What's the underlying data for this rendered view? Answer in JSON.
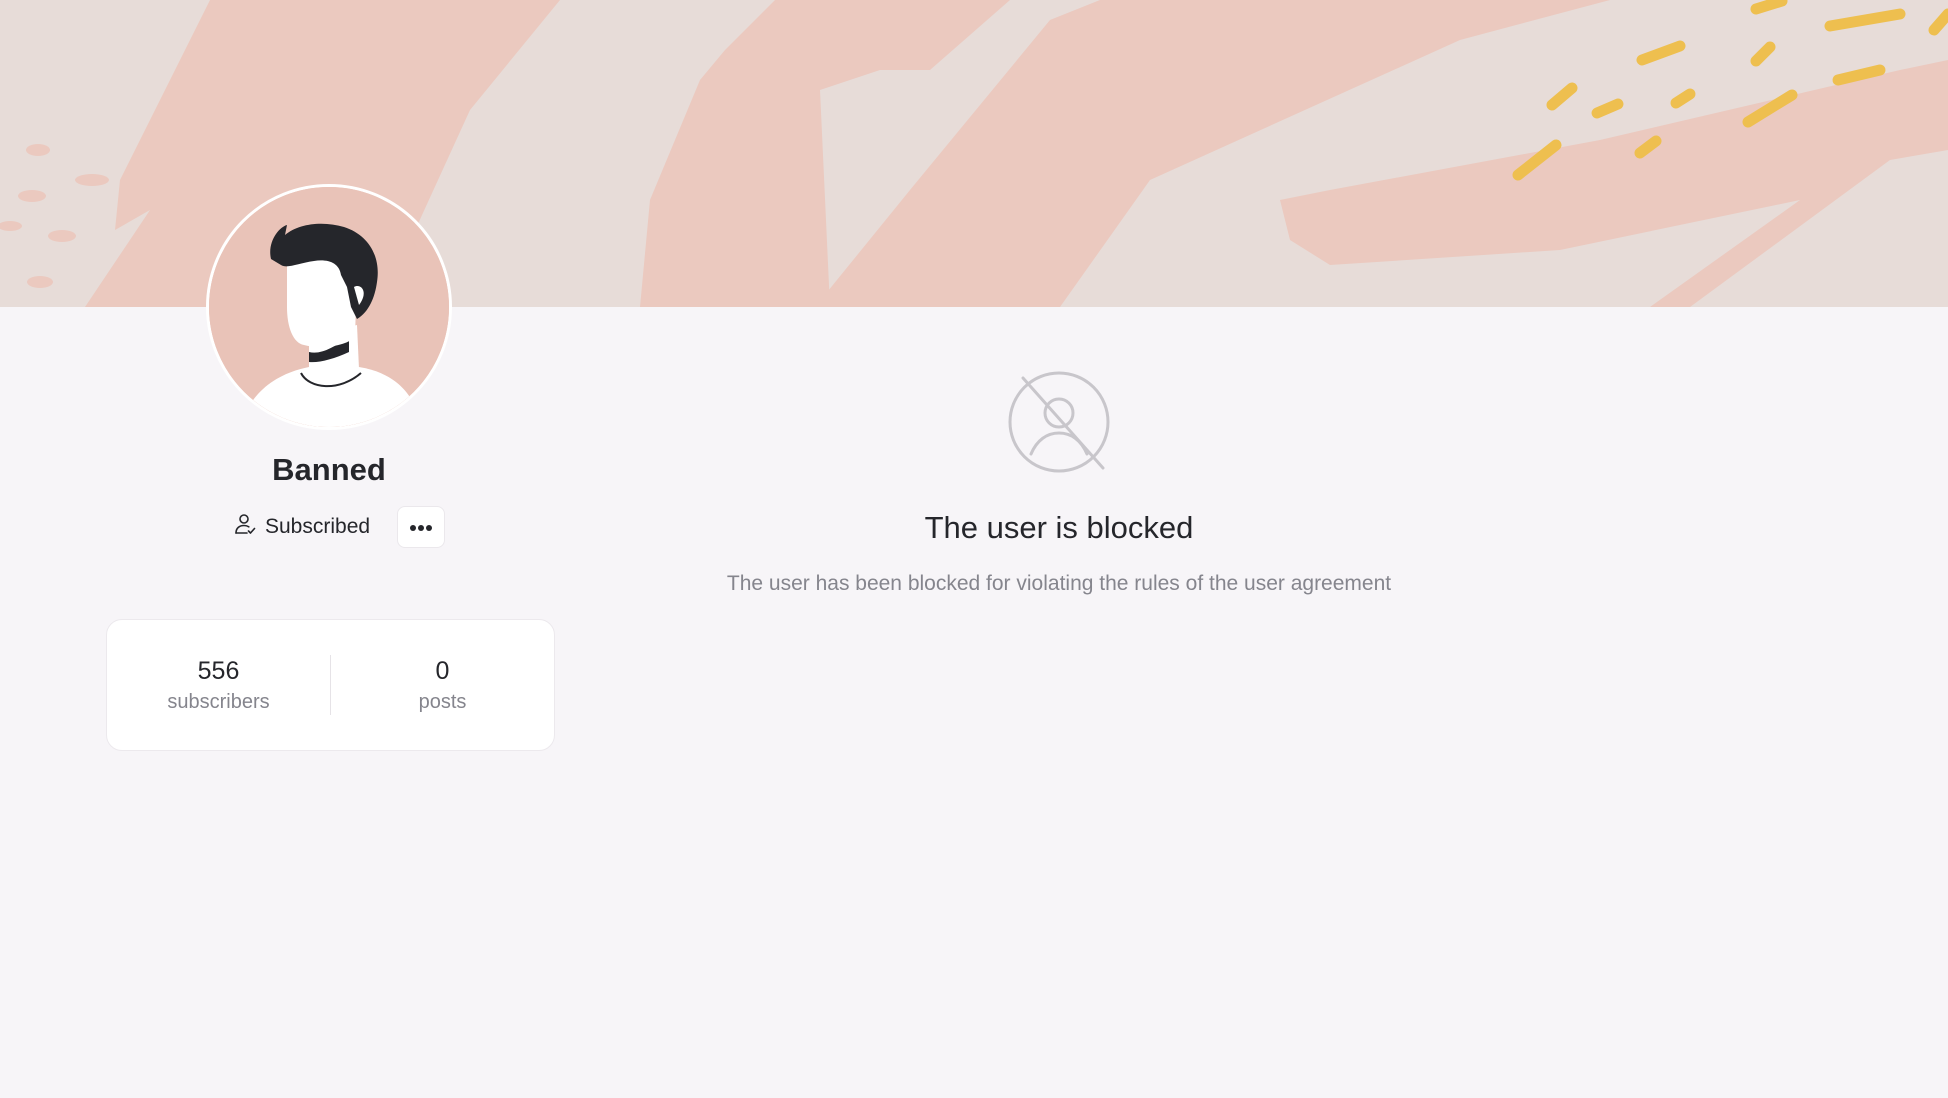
{
  "profile": {
    "name": "Banned",
    "subscribe_label": "Subscribed",
    "more_icon": "more-horizontal-icon",
    "subscribe_icon": "user-check-icon"
  },
  "stats": {
    "subscribers": {
      "value": "556",
      "label": "subscribers"
    },
    "posts": {
      "value": "0",
      "label": "posts"
    }
  },
  "blocked": {
    "icon": "user-blocked-icon",
    "title": "The user is blocked",
    "description": "The user has been blocked for violating the rules of the user agreement"
  },
  "colors": {
    "page_background": "#f7f5f8",
    "cover_base": "#e7dcd8",
    "cover_brush": "#ebc9bf",
    "cover_accent": "#eebf4f",
    "text_primary": "#25262b",
    "text_secondary": "#85858d"
  }
}
